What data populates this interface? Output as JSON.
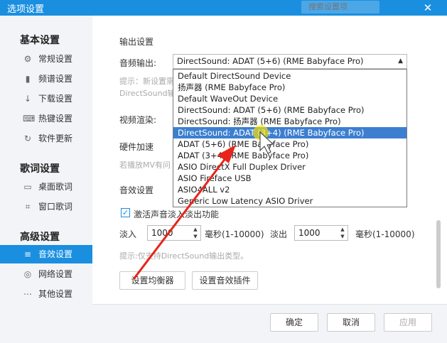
{
  "window": {
    "title": "选项设置",
    "search_placeholder": "搜索设置项",
    "close": "✕"
  },
  "sidebar": {
    "sections": [
      "基本设置",
      "歌词设置",
      "高级设置"
    ],
    "items": [
      {
        "label": "常规设置",
        "icon": "⚙"
      },
      {
        "label": "频谱设置",
        "icon": "▮"
      },
      {
        "label": "下载设置",
        "icon": "↓"
      },
      {
        "label": "热键设置",
        "icon": "⌨"
      },
      {
        "label": "软件更新",
        "icon": "↻"
      },
      {
        "label": "桌面歌词",
        "icon": "▭"
      },
      {
        "label": "窗口歌词",
        "icon": "⌗"
      },
      {
        "label": "音效设置",
        "icon": "≡"
      },
      {
        "label": "网络设置",
        "icon": "◎"
      },
      {
        "label": "其他设置",
        "icon": "⋯"
      }
    ]
  },
  "output": {
    "heading": "输出设置",
    "audio_output_label": "音频输出:",
    "selected": "DirectSound: ADAT (5+6) (RME Babyface Pro)",
    "hint1": "提示：新设置需",
    "hint2": "DirectSound输",
    "video_label": "视频渲染:",
    "hw_label": "硬件加速",
    "hw_hint": "若播放MV有问"
  },
  "dropdown_options": [
    "Default DirectSound Device",
    "扬声器 (RME Babyface Pro)",
    "Default WaveOut Device",
    "DirectSound: ADAT (5+6) (RME Babyface Pro)",
    "DirectSound: 扬声器 (RME Babyface Pro)",
    "DirectSound: ADAT (3+4) (RME Babyface Pro)",
    "ADAT (5+6) (RME Babyface Pro)",
    "ADAT (3+4) (RME Babyface Pro)",
    "ASIO DirectX Full Duplex Driver",
    "ASIO Fireface USB",
    "ASIO4ALL v2",
    "Generic Low Latency ASIO Driver"
  ],
  "effects": {
    "heading": "音效设置",
    "fade_checkbox": "激活声音淡入淡出功能",
    "fade_in_label": "淡入",
    "fade_in_value": "1000",
    "fade_out_label": "淡出",
    "fade_out_value": "1000",
    "unit": "毫秒(1-10000)",
    "hint": "提示:仅支持DirectSound输出类型。",
    "eq_button": "设置均衡器",
    "plugin_button": "设置音效插件"
  },
  "footer": {
    "ok": "确定",
    "cancel": "取消",
    "apply": "应用"
  },
  "colors": {
    "accent": "#1a8fe0",
    "selection": "#3c7fd0",
    "annotation": "#e8241a"
  }
}
